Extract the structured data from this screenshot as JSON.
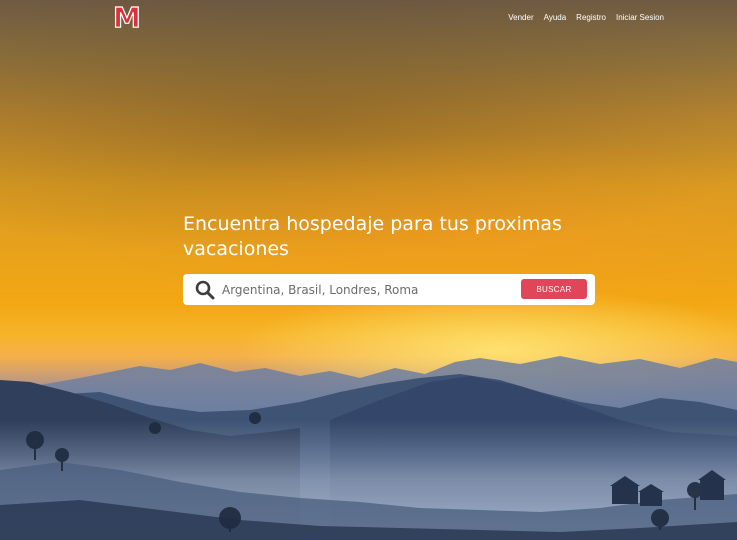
{
  "brand": {
    "logo_text": "M",
    "logo_color": "#d8323a"
  },
  "nav": {
    "items": [
      {
        "label": "Vender"
      },
      {
        "label": "Ayuda"
      },
      {
        "label": "Registro"
      },
      {
        "label": "Iniciar Sesion"
      }
    ]
  },
  "hero": {
    "title": "Encuentra hospedaje para tus proximas vacaciones"
  },
  "search": {
    "icon": "search-icon",
    "placeholder": "Argentina, Brasil, Londres, Roma",
    "value": "",
    "button_label": "BUSCAR",
    "button_color": "#e0465a"
  }
}
